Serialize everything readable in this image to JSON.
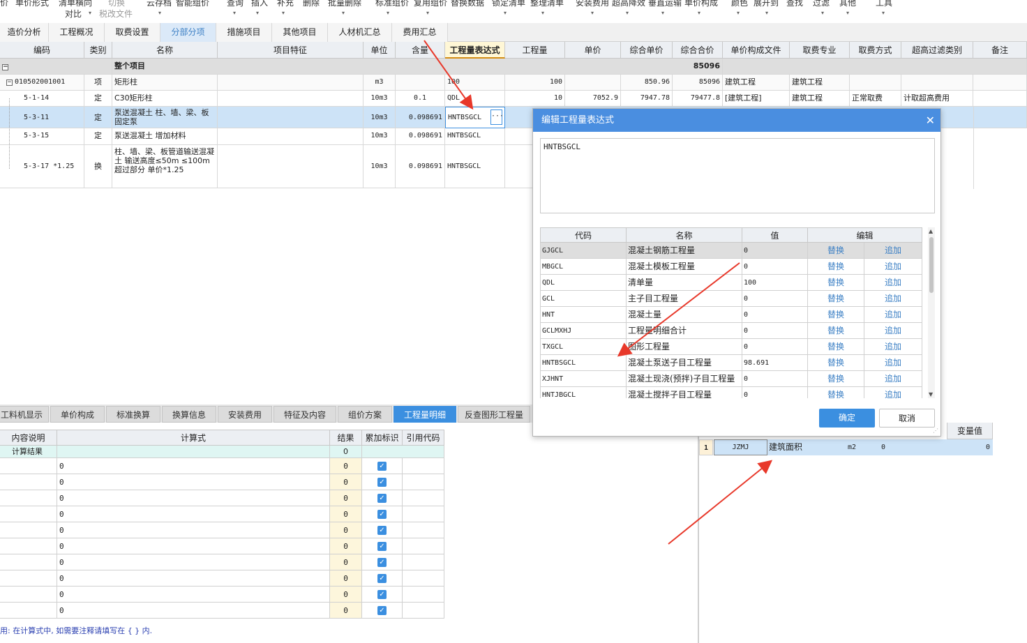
{
  "toolbar": {
    "items": [
      "价",
      "单价形式",
      "清单横向",
      "切换",
      "云存档",
      "智能组价",
      "查询",
      "插入",
      "补充",
      "删除",
      "批量删除",
      "标准组价",
      "复用组价",
      "替换数据",
      "锁定清单",
      "整理清单",
      "安装费用",
      "超高降效",
      "垂直运输",
      "单价构成",
      "颜色",
      "展开到",
      "查找",
      "过滤",
      "其他",
      "工具"
    ],
    "sub": [
      "对比",
      "税改文件"
    ]
  },
  "main_tabs": [
    "造价分析",
    "工程概况",
    "取费设置",
    "分部分项",
    "措施项目",
    "其他项目",
    "人材机汇总",
    "费用汇总"
  ],
  "main_active_tab": "分部分项",
  "grid": {
    "headers": [
      "编码",
      "类别",
      "名称",
      "项目特征",
      "单位",
      "含量",
      "工程量表达式",
      "工程量",
      "单价",
      "综合单价",
      "综合合价",
      "单价构成文件",
      "取费专业",
      "取费方式",
      "超高过滤类别",
      "备注"
    ],
    "summary": {
      "label": "整个项目",
      "total": "85096"
    },
    "rows": [
      {
        "code": "010502001001",
        "type": "项",
        "name": "矩形柱",
        "unit": "m3",
        "qty_ratio": "",
        "expr": "100",
        "qty": "100",
        "price": "",
        "comp_price": "850.96",
        "comp_total": "85096",
        "file": "建筑工程",
        "major": "建筑工程",
        "method": "",
        "filter": ""
      },
      {
        "code": "5-1-14",
        "type": "定",
        "name": "C30矩形柱",
        "unit": "10m3",
        "qty_ratio": "0.1",
        "expr": "QDL",
        "qty": "10",
        "price": "7052.9",
        "comp_price": "7947.78",
        "comp_total": "79477.8",
        "file": "[建筑工程]",
        "major": "建筑工程",
        "method": "正常取费",
        "filter": "计取超高费用"
      },
      {
        "code": "5-3-11",
        "type": "定",
        "name": "泵送混凝土 柱、墙、梁、板 固定泵",
        "unit": "10m3",
        "qty_ratio": "0.098691",
        "expr": "HNTBSGCL",
        "qty": "",
        "price": "",
        "comp_price": "",
        "comp_total": "",
        "file": "",
        "major": "",
        "method": "",
        "filter": ""
      },
      {
        "code": "5-3-15",
        "type": "定",
        "name": "泵送混凝土 增加材料",
        "unit": "10m3",
        "qty_ratio": "0.098691",
        "expr": "HNTBSGCL",
        "qty": "",
        "price": "",
        "comp_price": "",
        "comp_total": "",
        "file": "",
        "major": "",
        "method": "",
        "filter": ""
      },
      {
        "code": "5-3-17 *1.25",
        "type": "换",
        "name": "柱、墙、梁、板管道输送混凝土 输送高度≤50m ≤100m超过部分 单价*1.25",
        "unit": "10m3",
        "qty_ratio": "0.098691",
        "expr": "HNTBSGCL",
        "qty": "",
        "price": "",
        "comp_price": "",
        "comp_total": "",
        "file": "",
        "major": "",
        "method": "",
        "filter": ""
      }
    ],
    "ellipsis": "···"
  },
  "bottom_tabs": [
    "工料机显示",
    "单价构成",
    "标准换算",
    "换算信息",
    "安装费用",
    "特征及内容",
    "组价方案",
    "工程量明细",
    "反查图形工程量"
  ],
  "bottom_active_tab": "工程量明细",
  "calc_table": {
    "headers": [
      "内容说明",
      "计算式",
      "结果",
      "累加标识",
      "引用代码"
    ],
    "result_row": {
      "label": "计算结果",
      "result": "0"
    },
    "rows": [
      "0",
      "0",
      "0",
      "0",
      "0",
      "0",
      "0",
      "0",
      "0",
      "0"
    ],
    "result_values": [
      "0",
      "0",
      "0",
      "0",
      "0",
      "0",
      "0",
      "0",
      "0",
      "0"
    ],
    "check": "✓"
  },
  "hint": "用: 在计算式中, 如需要注释请填写在 { } 内.",
  "right_panel": {
    "headers": [
      "变量值"
    ],
    "row": {
      "index": "1",
      "code": "JZMJ",
      "name": "建筑面积",
      "unit": "m2",
      "value": "0",
      "var_value": "0"
    }
  },
  "dialog": {
    "title": "编辑工程量表达式",
    "close": "✕",
    "expression": "HNTBSGCL",
    "headers": [
      "代码",
      "名称",
      "值",
      "编辑"
    ],
    "replace_label": "替换",
    "append_label": "追加",
    "rows": [
      {
        "code": "GJGCL",
        "name": "混凝土钢筋工程量",
        "value": "0"
      },
      {
        "code": "MBGCL",
        "name": "混凝土模板工程量",
        "value": "0"
      },
      {
        "code": "QDL",
        "name": "清单量",
        "value": "100"
      },
      {
        "code": "GCL",
        "name": "主子目工程量",
        "value": "0"
      },
      {
        "code": "HNT",
        "name": "混凝土量",
        "value": "0"
      },
      {
        "code": "GCLMXHJ",
        "name": "工程量明细合计",
        "value": "0"
      },
      {
        "code": "TXGCL",
        "name": "图形工程量",
        "value": "0"
      },
      {
        "code": "HNTBSGCL",
        "name": "混凝土泵送子目工程量",
        "value": "98.691"
      },
      {
        "code": "XJHNT",
        "name": "混凝土现浇(预拌)子目工程量",
        "value": "0"
      },
      {
        "code": "HNTJBGCL",
        "name": "混凝土搅拌子目工程量",
        "value": "0"
      }
    ],
    "ok": "确定",
    "cancel": "取消"
  },
  "colors": {
    "accent": "#3b8fe0",
    "arrow": "#e8382a",
    "selected_row": "#cde3f7"
  }
}
